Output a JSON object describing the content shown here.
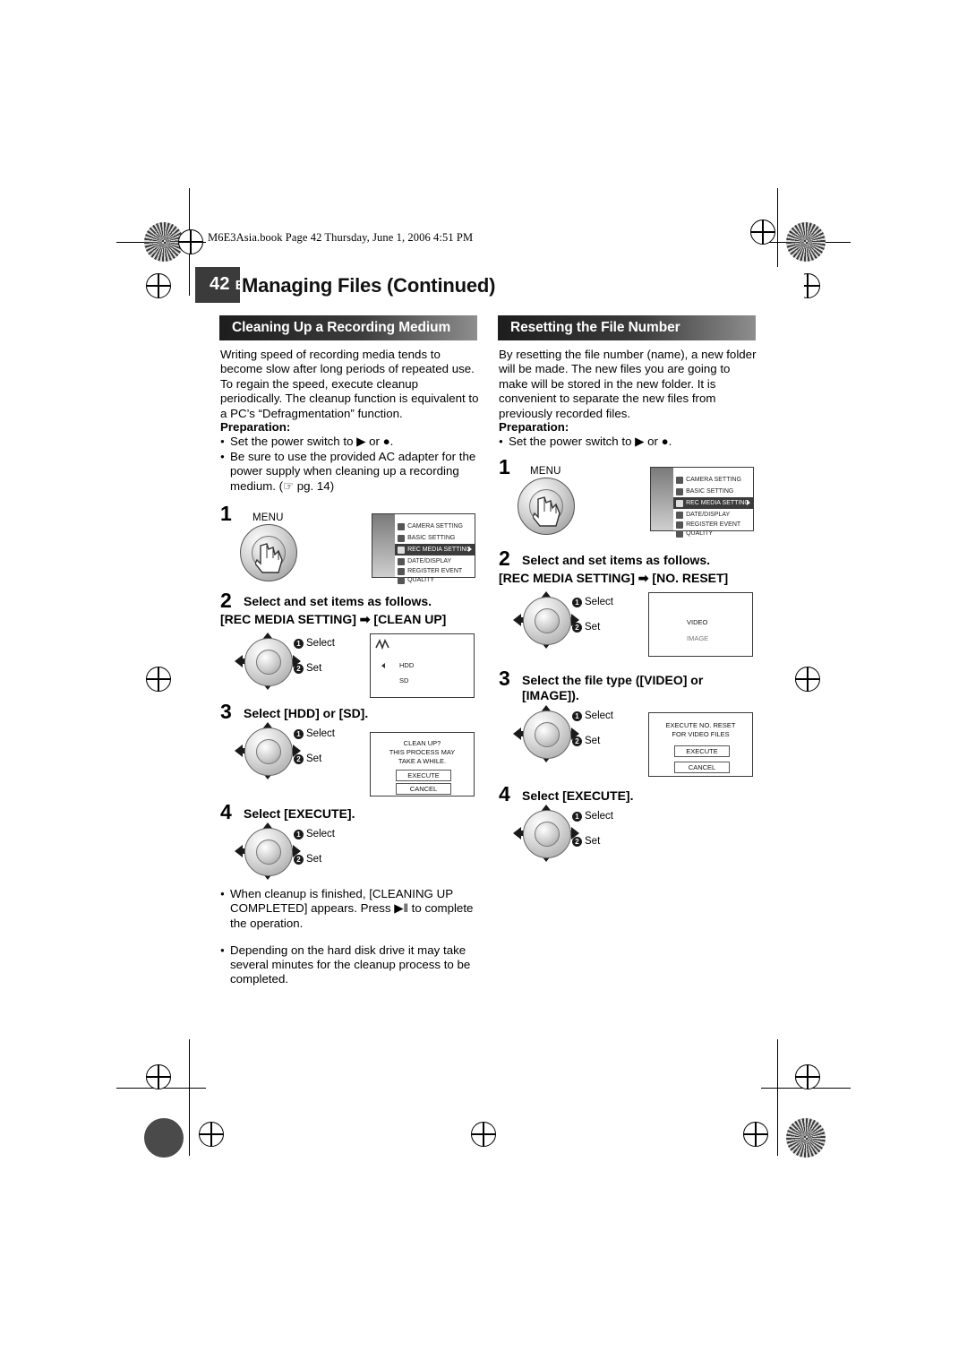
{
  "page": {
    "file_line": "M6E3Asia.book  Page 42  Thursday, June 1, 2006  4:51 PM",
    "page_number": "42",
    "page_lang": "EN",
    "title": "Managing Files (Continued)"
  },
  "left_section": {
    "heading": "Cleaning Up a Recording Medium",
    "intro": "Writing speed of recording media tends to become slow after long periods of repeated use. To regain the speed, execute cleanup periodically. The cleanup function is equivalent to a PC’s “Defragmentation” function.",
    "preparation_label": "Preparation:",
    "prep_items": [
      "Set the power switch to ▶ or ●.",
      "Be sure to use the provided AC adapter for the power supply when cleaning up a recording medium. (☞ pg. 14)"
    ],
    "steps": [
      {
        "num": "1",
        "text": "",
        "menu_label": "MENU"
      },
      {
        "num": "2",
        "text": "Select and set items as follows.",
        "sub": "[REC MEDIA SETTING] ➡ [CLEAN UP]"
      },
      {
        "num": "3",
        "text": "Select [HDD] or [SD]."
      },
      {
        "num": "4",
        "text": "Select [EXECUTE]."
      }
    ],
    "notes": [
      "When cleanup is finished, [CLEANING UP COMPLETED] appears. Press ▶‖ to complete the operation.",
      "Depending on the hard disk drive it may take several minutes for the cleanup process to be completed."
    ],
    "menu_screen": {
      "items": [
        "CAMERA SETTING",
        "BASIC SETTING",
        "REC MEDIA SETTING",
        "DATE/DISPLAY",
        "REGISTER EVENT",
        "QUALITY"
      ],
      "selected_index": 2
    },
    "media_panel": {
      "items": [
        "HDD",
        "SD"
      ]
    },
    "cleanup_panel": {
      "title_lines": [
        "CLEAN UP?",
        "THIS PROCESS MAY",
        "TAKE A WHILE."
      ],
      "buttons": [
        "EXECUTE",
        "CANCEL"
      ]
    },
    "stick_labels": {
      "select": "Select",
      "set": "Set",
      "n1": "1",
      "n2": "2"
    }
  },
  "right_section": {
    "heading": "Resetting the File Number",
    "intro": "By resetting the file number (name), a new folder will be made. The new files you are going to make will be stored in the new folder. It is convenient to separate the new files from previously recorded files.",
    "preparation_label": "Preparation:",
    "prep_items": [
      "Set the power switch to ▶ or ●."
    ],
    "steps": [
      {
        "num": "1",
        "text": "",
        "menu_label": "MENU"
      },
      {
        "num": "2",
        "text": "Select and set items as follows.",
        "sub": "[REC MEDIA SETTING] ➡ [NO. RESET]"
      },
      {
        "num": "3",
        "text": "Select the file type ([VIDEO] or [IMAGE])."
      },
      {
        "num": "4",
        "text": "Select [EXECUTE]."
      }
    ],
    "menu_screen": {
      "items": [
        "CAMERA SETTING",
        "BASIC SETTING",
        "REC MEDIA SETTING",
        "DATE/DISPLAY",
        "REGISTER EVENT",
        "QUALITY"
      ],
      "selected_index": 2
    },
    "type_panel": {
      "items": [
        "VIDEO",
        "IMAGE"
      ]
    },
    "reset_panel": {
      "title_lines": [
        "EXECUTE NO. RESET",
        "FOR VIDEO FILES"
      ],
      "buttons": [
        "EXECUTE",
        "CANCEL"
      ]
    },
    "stick_labels": {
      "select": "Select",
      "set": "Set",
      "n1": "1",
      "n2": "2"
    }
  }
}
